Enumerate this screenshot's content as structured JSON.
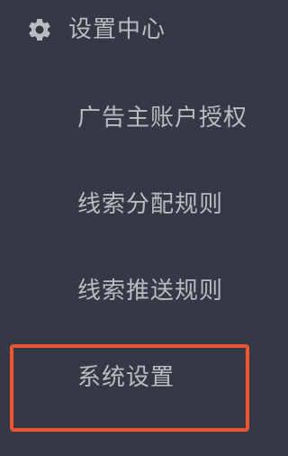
{
  "sidebar": {
    "section": {
      "icon": "gear-icon",
      "label": "设置中心"
    },
    "items": [
      {
        "label": "广告主账户授权"
      },
      {
        "label": "线索分配规则"
      },
      {
        "label": "线索推送规则"
      },
      {
        "label": "系统设置"
      }
    ],
    "highlighted_item": "系统设置",
    "colors": {
      "background": "#353945",
      "text": "#b9bcc3",
      "highlight_border": "#f0552f"
    }
  }
}
